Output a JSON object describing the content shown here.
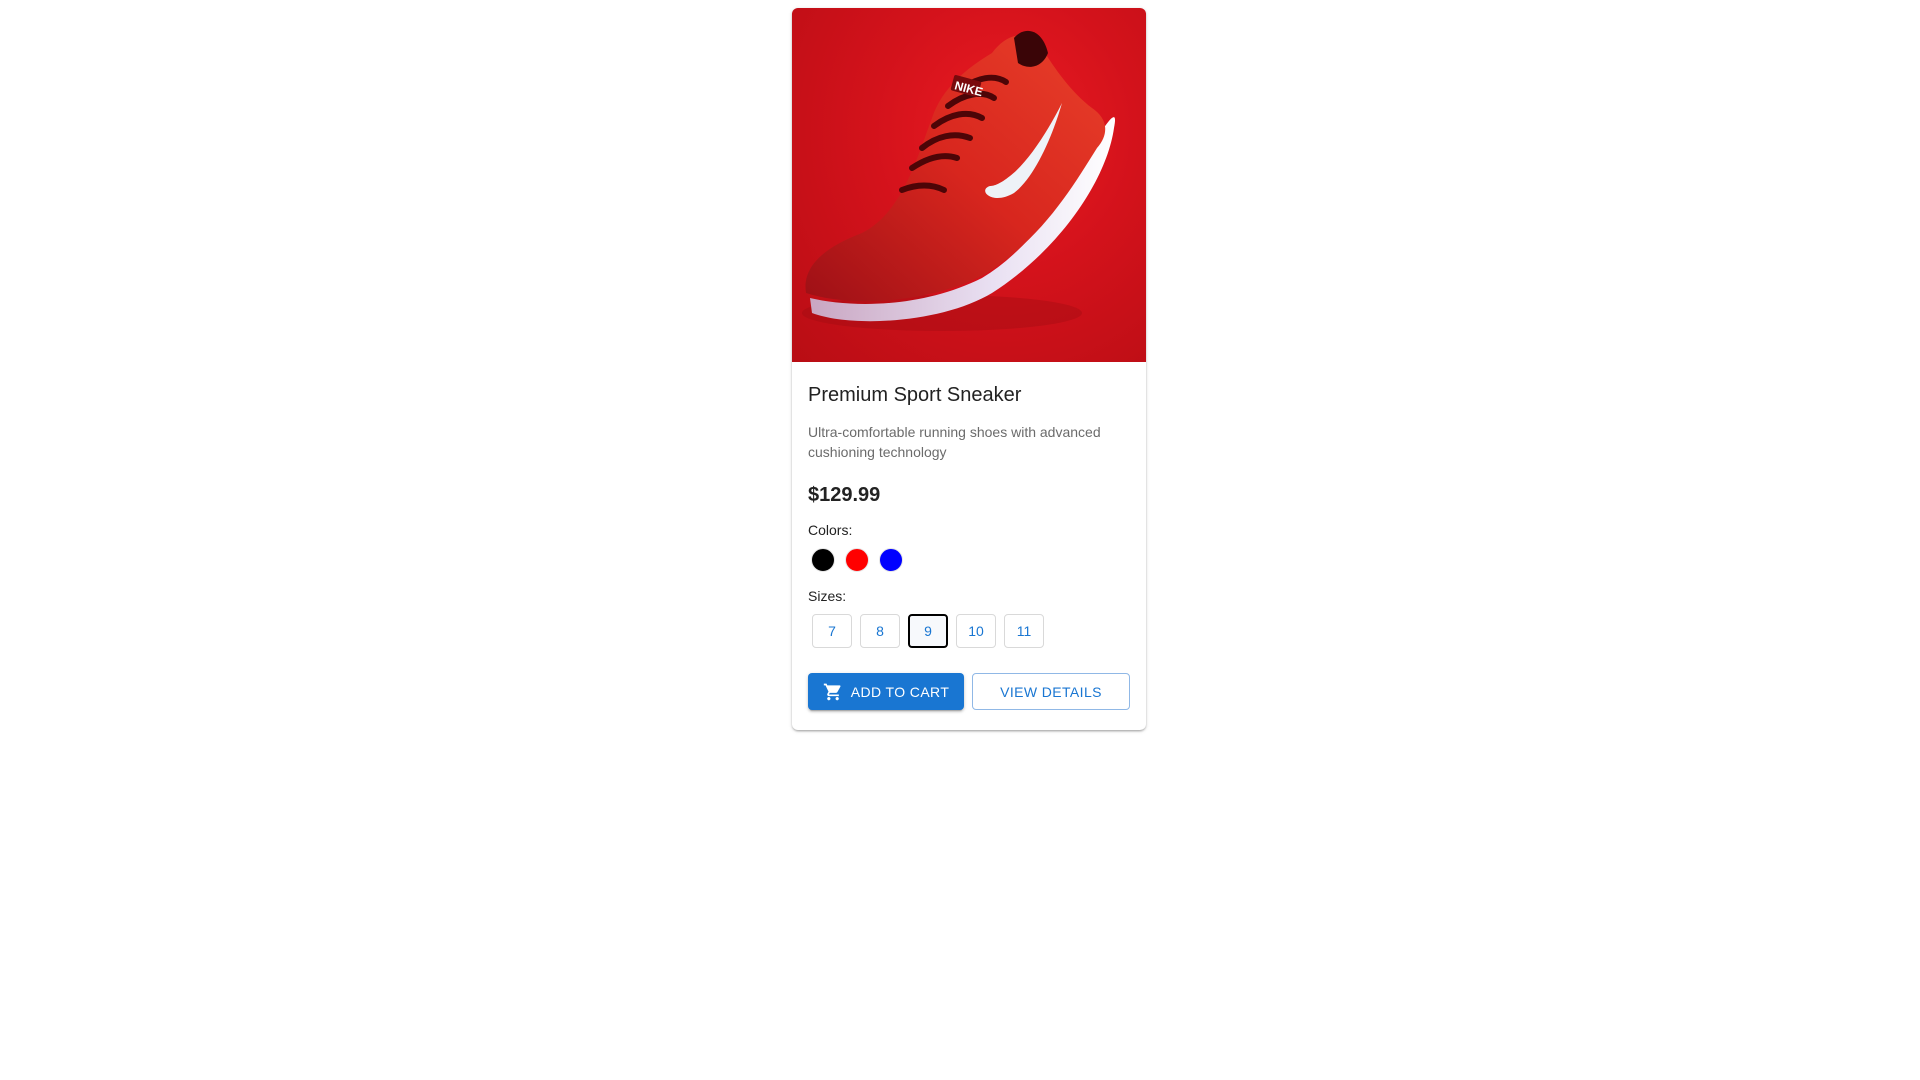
{
  "product": {
    "brand_mark": "NIKE",
    "title": "Premium Sport Sneaker",
    "description": "Ultra-comfortable running shoes with advanced cushioning technology",
    "price": "$129.99",
    "colors_label": "Colors:",
    "colors": [
      {
        "name": "black",
        "hex": "#000000"
      },
      {
        "name": "red",
        "hex": "#ff0000"
      },
      {
        "name": "blue",
        "hex": "#0000ff"
      }
    ],
    "sizes_label": "Sizes:",
    "sizes": [
      "7",
      "8",
      "9",
      "10",
      "11"
    ],
    "selected_size": "9"
  },
  "actions": {
    "add_to_cart_label": "ADD TO CART",
    "view_details_label": "VIEW DETAILS"
  },
  "theme": {
    "primary": "#1976d2",
    "image_background": "#d3121b"
  }
}
